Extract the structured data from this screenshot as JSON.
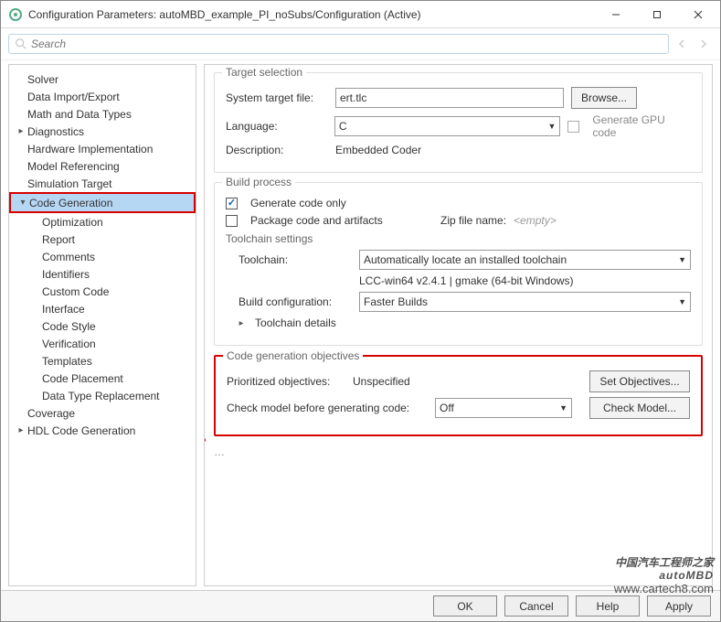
{
  "window": {
    "title": "Configuration Parameters: autoMBD_example_PI_noSubs/Configuration (Active)"
  },
  "search": {
    "placeholder": "Search"
  },
  "tree": {
    "items": [
      {
        "label": "Solver",
        "indent": 0,
        "arrow": ""
      },
      {
        "label": "Data Import/Export",
        "indent": 0,
        "arrow": ""
      },
      {
        "label": "Math and Data Types",
        "indent": 0,
        "arrow": ""
      },
      {
        "label": "Diagnostics",
        "indent": 0,
        "arrow": "▸"
      },
      {
        "label": "Hardware Implementation",
        "indent": 0,
        "arrow": ""
      },
      {
        "label": "Model Referencing",
        "indent": 0,
        "arrow": ""
      },
      {
        "label": "Simulation Target",
        "indent": 0,
        "arrow": ""
      },
      {
        "label": "Code Generation",
        "indent": 0,
        "arrow": "▾",
        "selected": true,
        "boxed": true
      },
      {
        "label": "Optimization",
        "indent": 1,
        "arrow": ""
      },
      {
        "label": "Report",
        "indent": 1,
        "arrow": ""
      },
      {
        "label": "Comments",
        "indent": 1,
        "arrow": ""
      },
      {
        "label": "Identifiers",
        "indent": 1,
        "arrow": ""
      },
      {
        "label": "Custom Code",
        "indent": 1,
        "arrow": ""
      },
      {
        "label": "Interface",
        "indent": 1,
        "arrow": ""
      },
      {
        "label": "Code Style",
        "indent": 1,
        "arrow": ""
      },
      {
        "label": "Verification",
        "indent": 1,
        "arrow": ""
      },
      {
        "label": "Templates",
        "indent": 1,
        "arrow": ""
      },
      {
        "label": "Code Placement",
        "indent": 1,
        "arrow": ""
      },
      {
        "label": "Data Type Replacement",
        "indent": 1,
        "arrow": ""
      },
      {
        "label": "Coverage",
        "indent": 0,
        "arrow": ""
      },
      {
        "label": "HDL Code Generation",
        "indent": 0,
        "arrow": "▸"
      }
    ]
  },
  "target": {
    "legend": "Target selection",
    "stf_label": "System target file:",
    "stf_value": "ert.tlc",
    "browse": "Browse...",
    "lang_label": "Language:",
    "lang_value": "C",
    "gpu_label": "Generate GPU code",
    "desc_label": "Description:",
    "desc_value": "Embedded Coder"
  },
  "build": {
    "legend": "Build process",
    "gen_only": "Generate code only",
    "package": "Package code and artifacts",
    "zip_label": "Zip file name:",
    "zip_placeholder": "<empty>",
    "tc_settings": "Toolchain settings",
    "tc_label": "Toolchain:",
    "tc_value": "Automatically locate an installed toolchain",
    "tc_info": "LCC-win64 v2.4.1 | gmake (64-bit Windows)",
    "bc_label": "Build configuration:",
    "bc_value": "Faster Builds",
    "tc_details": "Toolchain details"
  },
  "obj": {
    "legend": "Code generation objectives",
    "prio_label": "Prioritized objectives:",
    "prio_value": "Unspecified",
    "set_btn": "Set Objectives...",
    "check_label": "Check model before generating code:",
    "check_value": "Off",
    "check_btn": "Check Model..."
  },
  "footer": {
    "ok": "OK",
    "cancel": "Cancel",
    "help": "Help",
    "apply": "Apply"
  },
  "watermark": {
    "l1": "中国汽车工程师之家",
    "l2": "autoMBD",
    "l3": "www.cartech8.com"
  }
}
